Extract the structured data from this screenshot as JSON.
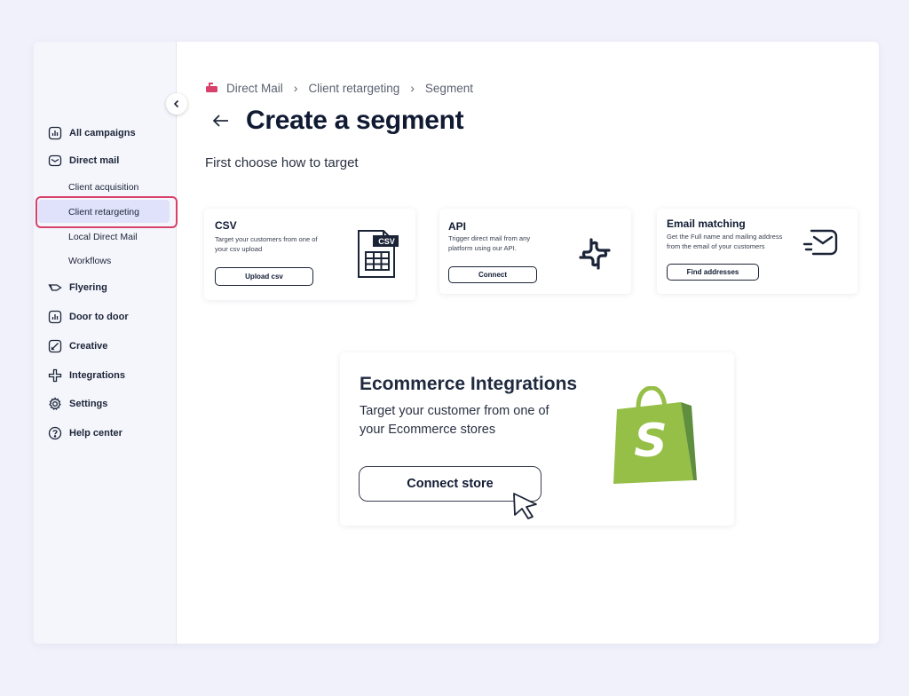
{
  "sidebar": {
    "items": [
      {
        "label": "All campaigns",
        "icon": "bar-chart-icon"
      },
      {
        "label": "Direct mail",
        "icon": "mail-icon"
      },
      {
        "label": "Flyering",
        "icon": "flyer-icon"
      },
      {
        "label": "Door to door",
        "icon": "bar-chart-icon"
      },
      {
        "label": "Creative",
        "icon": "brush-icon"
      },
      {
        "label": "Integrations",
        "icon": "integrations-icon"
      },
      {
        "label": "Settings",
        "icon": "gear-icon"
      },
      {
        "label": "Help center",
        "icon": "help-icon"
      }
    ],
    "sub_items": [
      {
        "label": "Client acquisition"
      },
      {
        "label": "Client retargeting",
        "selected": true
      },
      {
        "label": "Local Direct Mail"
      },
      {
        "label": "Workflows"
      }
    ]
  },
  "breadcrumb": {
    "items": [
      "Direct Mail",
      "Client retargeting",
      "Segment"
    ],
    "icon": "mailbox-icon"
  },
  "page": {
    "title": "Create a segment",
    "subtitle": "First choose how to target"
  },
  "cards": {
    "csv": {
      "title": "CSV",
      "description": "Target your customers from one of your csv upload",
      "button": "Upload csv",
      "badge": "CSV"
    },
    "api": {
      "title": "API",
      "description": "Trigger direct mail from any platform using our API.",
      "button": "Connect"
    },
    "email": {
      "title": "Email matching",
      "description": "Get the Full name and mailing address from the email of your customers",
      "button": "Find addresses"
    }
  },
  "ecommerce": {
    "title": "Ecommerce Integrations",
    "description": "Target your customer from one of your Ecommerce stores",
    "button": "Connect store",
    "logo_letter": "S"
  },
  "colors": {
    "accent_highlight": "#dfe2fa",
    "selection_outline": "#d8416a",
    "shopify_green": "#95bf47",
    "shopify_dark": "#5e8e3e",
    "text_dark": "#101a33",
    "mailbox_red": "#d8416a"
  }
}
